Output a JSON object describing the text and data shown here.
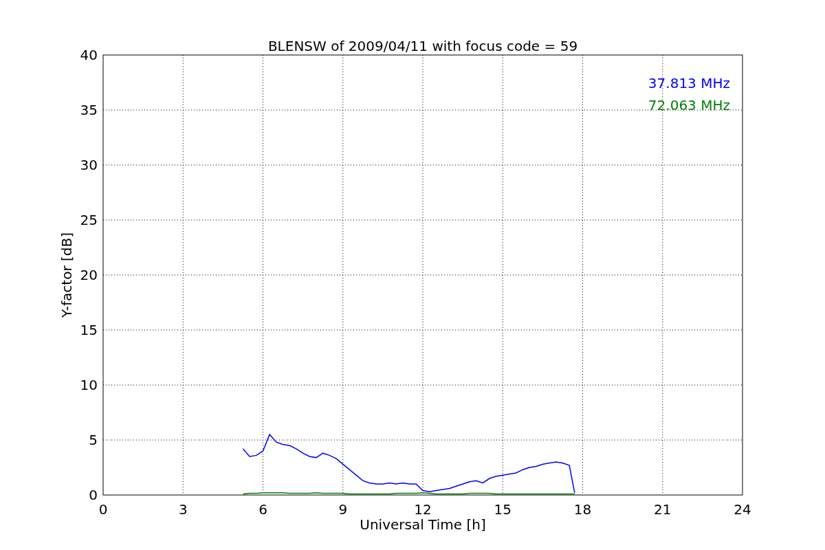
{
  "chart_data": {
    "type": "line",
    "title": "BLENSW of 2009/04/11 with focus code = 59",
    "xlabel": "Universal Time [h]",
    "ylabel": "Y-factor [dB]",
    "x": [
      5.25,
      5.5,
      5.75,
      6.0,
      6.25,
      6.5,
      6.75,
      7.0,
      7.25,
      7.5,
      7.75,
      8.0,
      8.25,
      8.5,
      8.75,
      9.0,
      9.25,
      9.5,
      9.75,
      10.0,
      10.25,
      10.5,
      10.75,
      11.0,
      11.25,
      11.5,
      11.75,
      12.0,
      12.25,
      12.5,
      12.75,
      13.0,
      13.25,
      13.5,
      13.75,
      14.0,
      14.25,
      14.5,
      14.75,
      15.0,
      15.25,
      15.5,
      15.75,
      16.0,
      16.25,
      16.5,
      16.75,
      17.0,
      17.25,
      17.5,
      17.7
    ],
    "series": [
      {
        "name": "37.813 MHz",
        "color": "#0000ff",
        "values": [
          4.2,
          3.5,
          3.6,
          4.0,
          5.5,
          4.8,
          4.6,
          4.5,
          4.2,
          3.8,
          3.5,
          3.4,
          3.8,
          3.6,
          3.3,
          2.8,
          2.3,
          1.8,
          1.3,
          1.1,
          1.0,
          1.0,
          1.1,
          1.0,
          1.1,
          1.0,
          1.0,
          0.4,
          0.3,
          0.4,
          0.5,
          0.6,
          0.8,
          1.0,
          1.2,
          1.3,
          1.1,
          1.5,
          1.7,
          1.8,
          1.9,
          2.0,
          2.3,
          2.5,
          2.6,
          2.8,
          2.9,
          3.0,
          2.9,
          2.7,
          0.2
        ]
      },
      {
        "name": "72.063 MHz",
        "color": "#008000",
        "values": [
          0.1,
          0.15,
          0.15,
          0.2,
          0.2,
          0.2,
          0.2,
          0.15,
          0.15,
          0.15,
          0.15,
          0.2,
          0.15,
          0.15,
          0.15,
          0.15,
          0.1,
          0.1,
          0.1,
          0.1,
          0.1,
          0.1,
          0.1,
          0.15,
          0.15,
          0.15,
          0.15,
          0.2,
          0.15,
          0.1,
          0.1,
          0.1,
          0.1,
          0.1,
          0.15,
          0.15,
          0.15,
          0.15,
          0.1,
          0.1,
          0.1,
          0.1,
          0.1,
          0.1,
          0.1,
          0.1,
          0.1,
          0.1,
          0.1,
          0.1,
          0.1
        ]
      }
    ],
    "xlim": [
      0,
      24
    ],
    "ylim": [
      0,
      40
    ],
    "xticks": [
      0,
      3,
      6,
      9,
      12,
      15,
      18,
      21,
      24
    ],
    "yticks": [
      0,
      5,
      10,
      15,
      20,
      25,
      30,
      35,
      40
    ],
    "grid": true
  }
}
